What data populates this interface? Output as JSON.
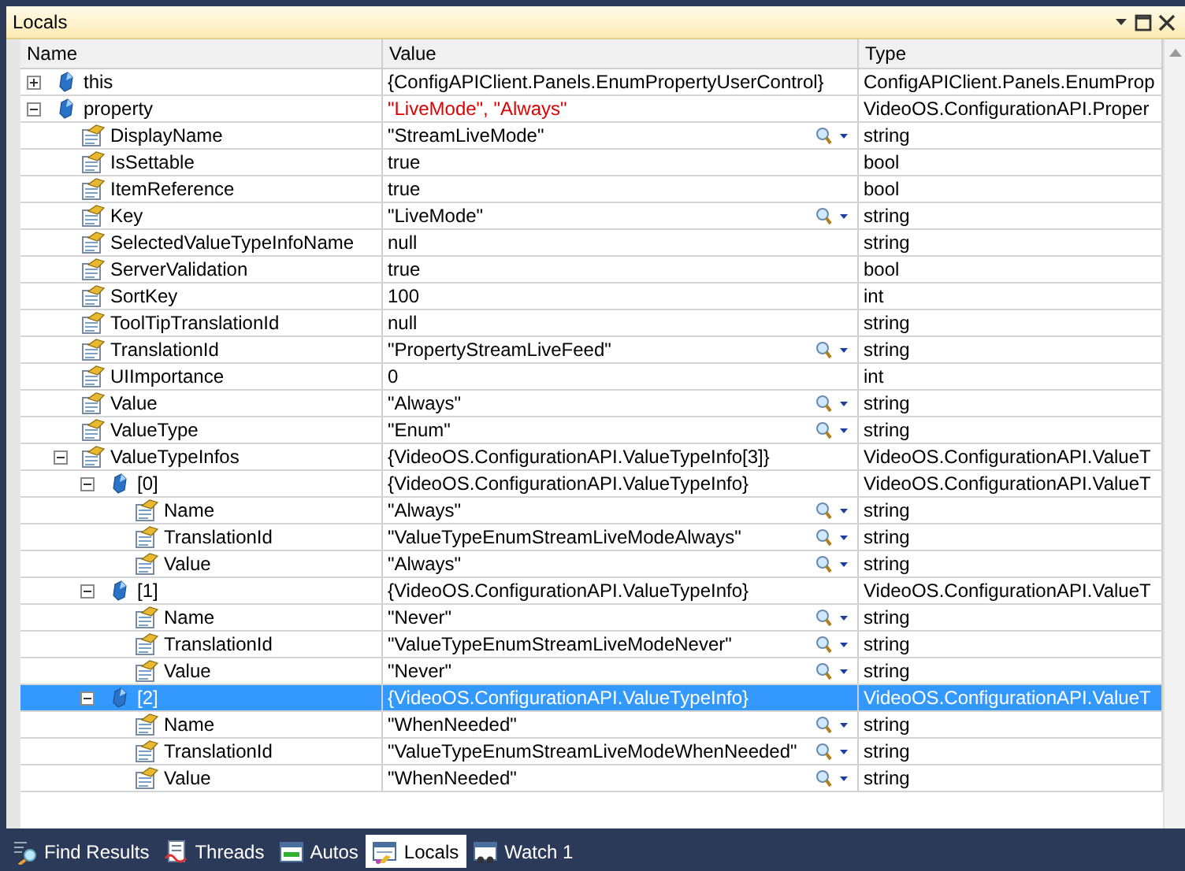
{
  "window": {
    "title": "Locals"
  },
  "table": {
    "columns": [
      "Name",
      "Value",
      "Type"
    ],
    "rows": [
      {
        "kind": "object",
        "name": "this",
        "value": "{ConfigAPIClient.Panels.EnumPropertyUserControl}",
        "type": "ConfigAPIClient.Panels.EnumProp",
        "expanded": false,
        "changed": false,
        "visualizer": false,
        "selected": false
      },
      {
        "kind": "object",
        "name": "property",
        "value": "\"LiveMode\", \"Always\"",
        "type": "VideoOS.ConfigurationAPI.Proper",
        "expanded": true,
        "changed": true,
        "visualizer": false,
        "selected": false,
        "children": [
          {
            "kind": "property",
            "name": "DisplayName",
            "value": "\"StreamLiveMode\"",
            "type": "string",
            "changed": false,
            "visualizer": true,
            "selected": false
          },
          {
            "kind": "property",
            "name": "IsSettable",
            "value": "true",
            "type": "bool",
            "changed": false,
            "visualizer": false,
            "selected": false
          },
          {
            "kind": "property",
            "name": "ItemReference",
            "value": "true",
            "type": "bool",
            "changed": false,
            "visualizer": false,
            "selected": false
          },
          {
            "kind": "property",
            "name": "Key",
            "value": "\"LiveMode\"",
            "type": "string",
            "changed": false,
            "visualizer": true,
            "selected": false
          },
          {
            "kind": "property",
            "name": "SelectedValueTypeInfoName",
            "value": "null",
            "type": "string",
            "changed": false,
            "visualizer": false,
            "selected": false
          },
          {
            "kind": "property",
            "name": "ServerValidation",
            "value": "true",
            "type": "bool",
            "changed": false,
            "visualizer": false,
            "selected": false
          },
          {
            "kind": "property",
            "name": "SortKey",
            "value": "100",
            "type": "int",
            "changed": false,
            "visualizer": false,
            "selected": false
          },
          {
            "kind": "property",
            "name": "ToolTipTranslationId",
            "value": "null",
            "type": "string",
            "changed": false,
            "visualizer": false,
            "selected": false
          },
          {
            "kind": "property",
            "name": "TranslationId",
            "value": "\"PropertyStreamLiveFeed\"",
            "type": "string",
            "changed": false,
            "visualizer": true,
            "selected": false
          },
          {
            "kind": "property",
            "name": "UIImportance",
            "value": "0",
            "type": "int",
            "changed": false,
            "visualizer": false,
            "selected": false
          },
          {
            "kind": "property",
            "name": "Value",
            "value": "\"Always\"",
            "type": "string",
            "changed": false,
            "visualizer": true,
            "selected": false
          },
          {
            "kind": "property",
            "name": "ValueType",
            "value": "\"Enum\"",
            "type": "string",
            "changed": false,
            "visualizer": true,
            "selected": false
          },
          {
            "kind": "property",
            "name": "ValueTypeInfos",
            "value": "{VideoOS.ConfigurationAPI.ValueTypeInfo[3]}",
            "type": "VideoOS.ConfigurationAPI.ValueT",
            "expanded": true,
            "changed": false,
            "visualizer": false,
            "selected": false,
            "children": [
              {
                "kind": "object",
                "name": "[0]",
                "value": "{VideoOS.ConfigurationAPI.ValueTypeInfo}",
                "type": "VideoOS.ConfigurationAPI.ValueT",
                "expanded": true,
                "changed": false,
                "visualizer": false,
                "selected": false,
                "children": [
                  {
                    "kind": "property",
                    "name": "Name",
                    "value": "\"Always\"",
                    "type": "string",
                    "changed": false,
                    "visualizer": true,
                    "selected": false
                  },
                  {
                    "kind": "property",
                    "name": "TranslationId",
                    "value": "\"ValueTypeEnumStreamLiveModeAlways\"",
                    "type": "string",
                    "changed": false,
                    "visualizer": true,
                    "selected": false
                  },
                  {
                    "kind": "property",
                    "name": "Value",
                    "value": "\"Always\"",
                    "type": "string",
                    "changed": false,
                    "visualizer": true,
                    "selected": false
                  }
                ]
              },
              {
                "kind": "object",
                "name": "[1]",
                "value": "{VideoOS.ConfigurationAPI.ValueTypeInfo}",
                "type": "VideoOS.ConfigurationAPI.ValueT",
                "expanded": true,
                "changed": false,
                "visualizer": false,
                "selected": false,
                "children": [
                  {
                    "kind": "property",
                    "name": "Name",
                    "value": "\"Never\"",
                    "type": "string",
                    "changed": false,
                    "visualizer": true,
                    "selected": false
                  },
                  {
                    "kind": "property",
                    "name": "TranslationId",
                    "value": "\"ValueTypeEnumStreamLiveModeNever\"",
                    "type": "string",
                    "changed": false,
                    "visualizer": true,
                    "selected": false
                  },
                  {
                    "kind": "property",
                    "name": "Value",
                    "value": "\"Never\"",
                    "type": "string",
                    "changed": false,
                    "visualizer": true,
                    "selected": false
                  }
                ]
              },
              {
                "kind": "object",
                "name": "[2]",
                "value": "{VideoOS.ConfigurationAPI.ValueTypeInfo}",
                "type": "VideoOS.ConfigurationAPI.ValueT",
                "expanded": true,
                "changed": false,
                "visualizer": false,
                "selected": true,
                "children": [
                  {
                    "kind": "property",
                    "name": "Name",
                    "value": "\"WhenNeeded\"",
                    "type": "string",
                    "changed": false,
                    "visualizer": true,
                    "selected": false
                  },
                  {
                    "kind": "property",
                    "name": "TranslationId",
                    "value": "\"ValueTypeEnumStreamLiveModeWhenNeeded\"",
                    "type": "string",
                    "changed": false,
                    "visualizer": true,
                    "selected": false
                  },
                  {
                    "kind": "property",
                    "name": "Value",
                    "value": "\"WhenNeeded\"",
                    "type": "string",
                    "changed": false,
                    "visualizer": true,
                    "selected": false
                  }
                ]
              }
            ]
          }
        ]
      }
    ]
  },
  "tool_tabs": [
    {
      "kind": "find",
      "label": "Find Results",
      "selected": false
    },
    {
      "kind": "threads",
      "label": "Threads",
      "selected": false
    },
    {
      "kind": "autos",
      "label": "Autos",
      "selected": false
    },
    {
      "kind": "locals",
      "label": "Locals",
      "selected": true
    },
    {
      "kind": "watch",
      "label": "Watch 1",
      "selected": false
    }
  ]
}
